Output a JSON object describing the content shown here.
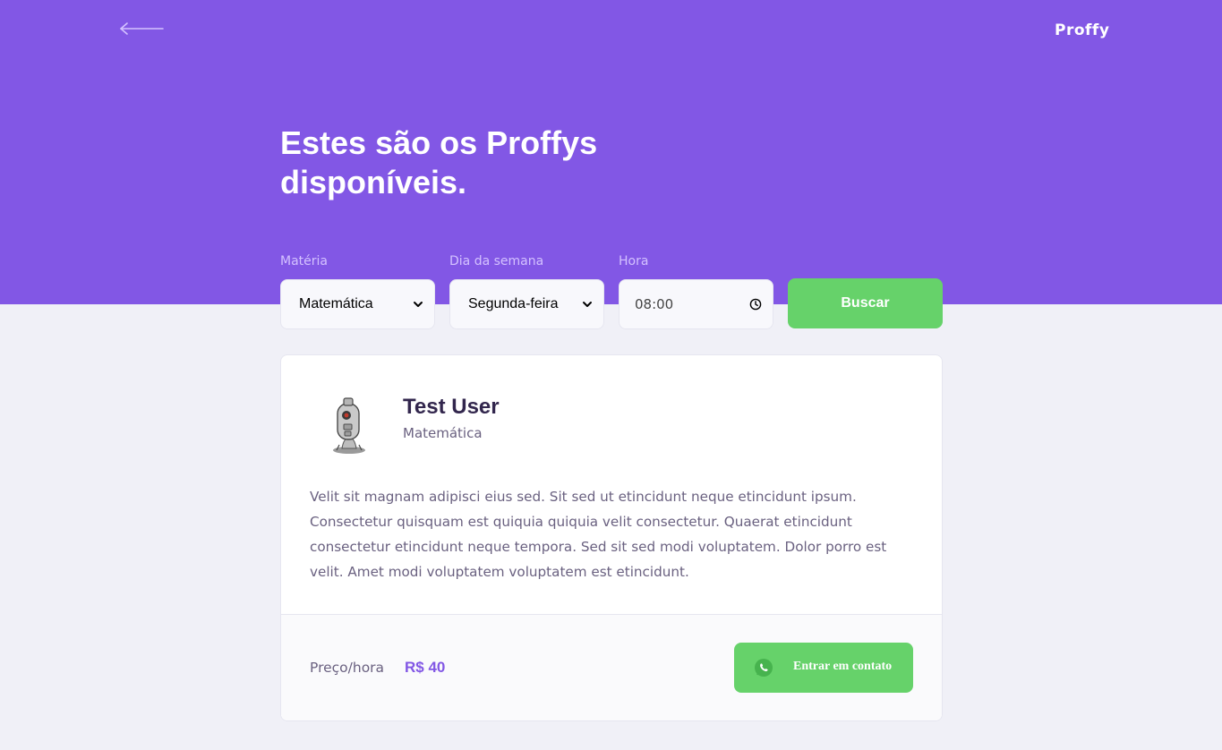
{
  "header": {
    "back_icon": "arrow-left-icon",
    "logo": "Proffy",
    "title": "Estes são os Proffys disponíveis."
  },
  "filters": {
    "subject_label": "Matéria",
    "subject_value": "Matemática",
    "weekday_label": "Dia da semana",
    "weekday_value": "Segunda-feira",
    "time_label": "Hora",
    "time_value": "08:00",
    "search_label": "Buscar"
  },
  "teacher": {
    "name": "Test User",
    "subject": "Matemática",
    "bio": "Velit sit magnam adipisci eius sed. Sit sed ut etincidunt neque etincidunt ipsum. Consectetur quisquam est quiquia quiquia velit consectetur. Quaerat etincidunt consectetur etincidunt neque tempora. Sed sit sed modi voluptatem. Dolor porro est velit. Amet modi voluptatem voluptatem est etincidunt.",
    "price_label": "Preço/hora",
    "price_value": "R$ 40",
    "contact_label": "Entrar em contato",
    "contact_icon": "whatsapp-icon"
  },
  "colors": {
    "primary": "#8257E5",
    "secondary": "#66D26A",
    "background": "#F0F0F7",
    "title_text": "#32264D",
    "body_text": "#6A6180"
  }
}
